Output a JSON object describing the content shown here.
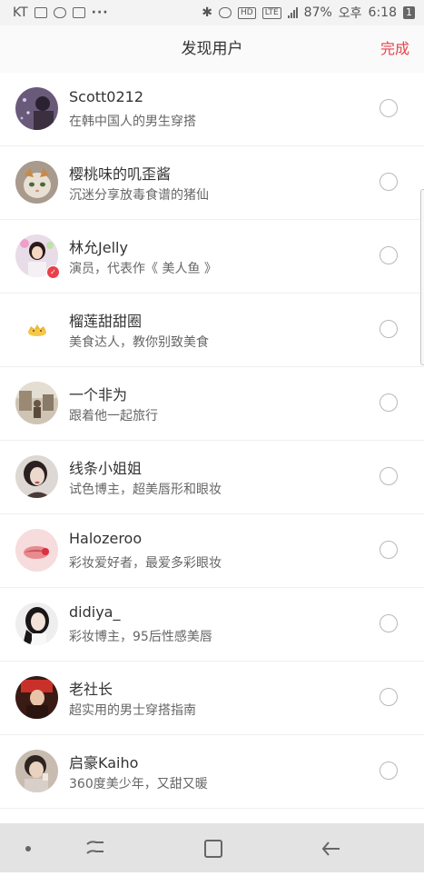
{
  "status_bar": {
    "carrier": "KT",
    "battery": "87%",
    "time_period": "오후",
    "time": "6:18",
    "notification_count": "1",
    "network": "LTE"
  },
  "header": {
    "title": "发现用户",
    "done_label": "完成",
    "accent_color": "#e8414a"
  },
  "users": [
    {
      "name": "Scott0212",
      "desc": "在韩中国人的男生穿搭"
    },
    {
      "name": "樱桃味的叽歪酱",
      "desc": "沉迷分享放毒食谱的猪仙"
    },
    {
      "name": "林允Jelly",
      "desc": "演员，代表作《 美人鱼 》"
    },
    {
      "name": "榴莲甜甜圈",
      "desc": "美食达人，教你别致美食"
    },
    {
      "name": "一个非为",
      "desc": "跟着他一起旅行"
    },
    {
      "name": "线条小姐姐",
      "desc": "试色博主，超美唇形和眼妆"
    },
    {
      "name": "Halozeroo",
      "desc": "彩妆爱好者，最爱多彩眼妆"
    },
    {
      "name": "didiya_",
      "desc": "彩妆博主，95后性感美唇"
    },
    {
      "name": "老社长",
      "desc": "超实用的男士穿搭指南"
    },
    {
      "name": "启豪Kaiho",
      "desc": "360度美少年，又甜又暖"
    }
  ],
  "nav_bar": {
    "icons": [
      "dot-icon",
      "recent-apps-icon",
      "home-icon",
      "back-icon"
    ]
  }
}
